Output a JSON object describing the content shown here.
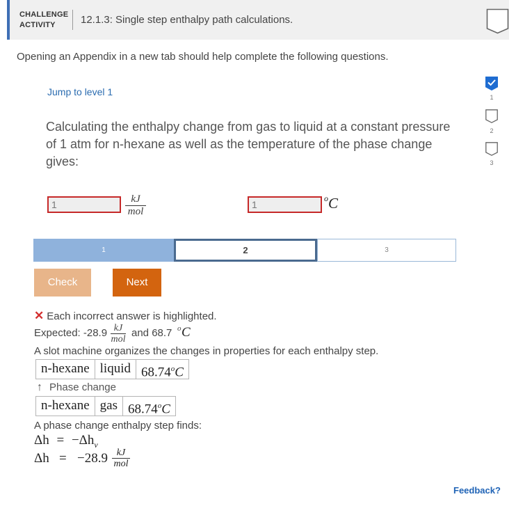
{
  "header": {
    "chip_line1": "CHALLENGE",
    "chip_line2": "ACTIVITY",
    "title": "12.1.3: Single step enthalpy path calculations."
  },
  "instructions": "Opening an Appendix in a new tab should help complete the following questions.",
  "jump_link": "Jump to level 1",
  "question": "Calculating the enthalpy change from gas to liquid at a constant pressure of 1 atm for n-hexane as well as the temperature of the phase change gives:",
  "answers": [
    {
      "value": "1",
      "unit_num": "kJ",
      "unit_den": "mol"
    },
    {
      "value": "1",
      "unit": "C",
      "unit_sup": "o"
    }
  ],
  "levels": {
    "items": [
      "1",
      "2",
      "3"
    ],
    "current": "2"
  },
  "buttons": {
    "check": "Check",
    "next": "Next"
  },
  "feedback": {
    "incorrect_msg": "Each incorrect answer is highlighted.",
    "expected_prefix": "Expected: -28.9",
    "expected_unit_num": "kJ",
    "expected_unit_den": "mol",
    "expected_and": "and 68.7",
    "expected_deg": "o",
    "expected_c": "C",
    "slot_text": "A slot machine organizes the changes in properties for each enthalpy step.",
    "state1": [
      "n-hexane",
      "liquid",
      "68.74"
    ],
    "state2": [
      "n-hexane",
      "gas",
      "68.74"
    ],
    "phase_label": "Phase change",
    "step_text": "A phase change enthalpy step finds:",
    "eq1_lhs": "Δh",
    "eq1_rhs": "−Δh",
    "eq1_sub": "v",
    "eq2_lhs": "Δh",
    "eq2_rhs": "−28.9",
    "eq2_unit_num": "kJ",
    "eq2_unit_den": "mol"
  },
  "rail": {
    "items": [
      "1",
      "2",
      "3"
    ],
    "completed": [
      "1"
    ]
  },
  "feedback_link": "Feedback?",
  "colors": {
    "accent": "#3f6fb5",
    "error": "#c62828",
    "next_button": "#d3640f",
    "check_button": "#e8b58a",
    "level_done": "#8fb2dc",
    "link": "#1f63b6"
  }
}
